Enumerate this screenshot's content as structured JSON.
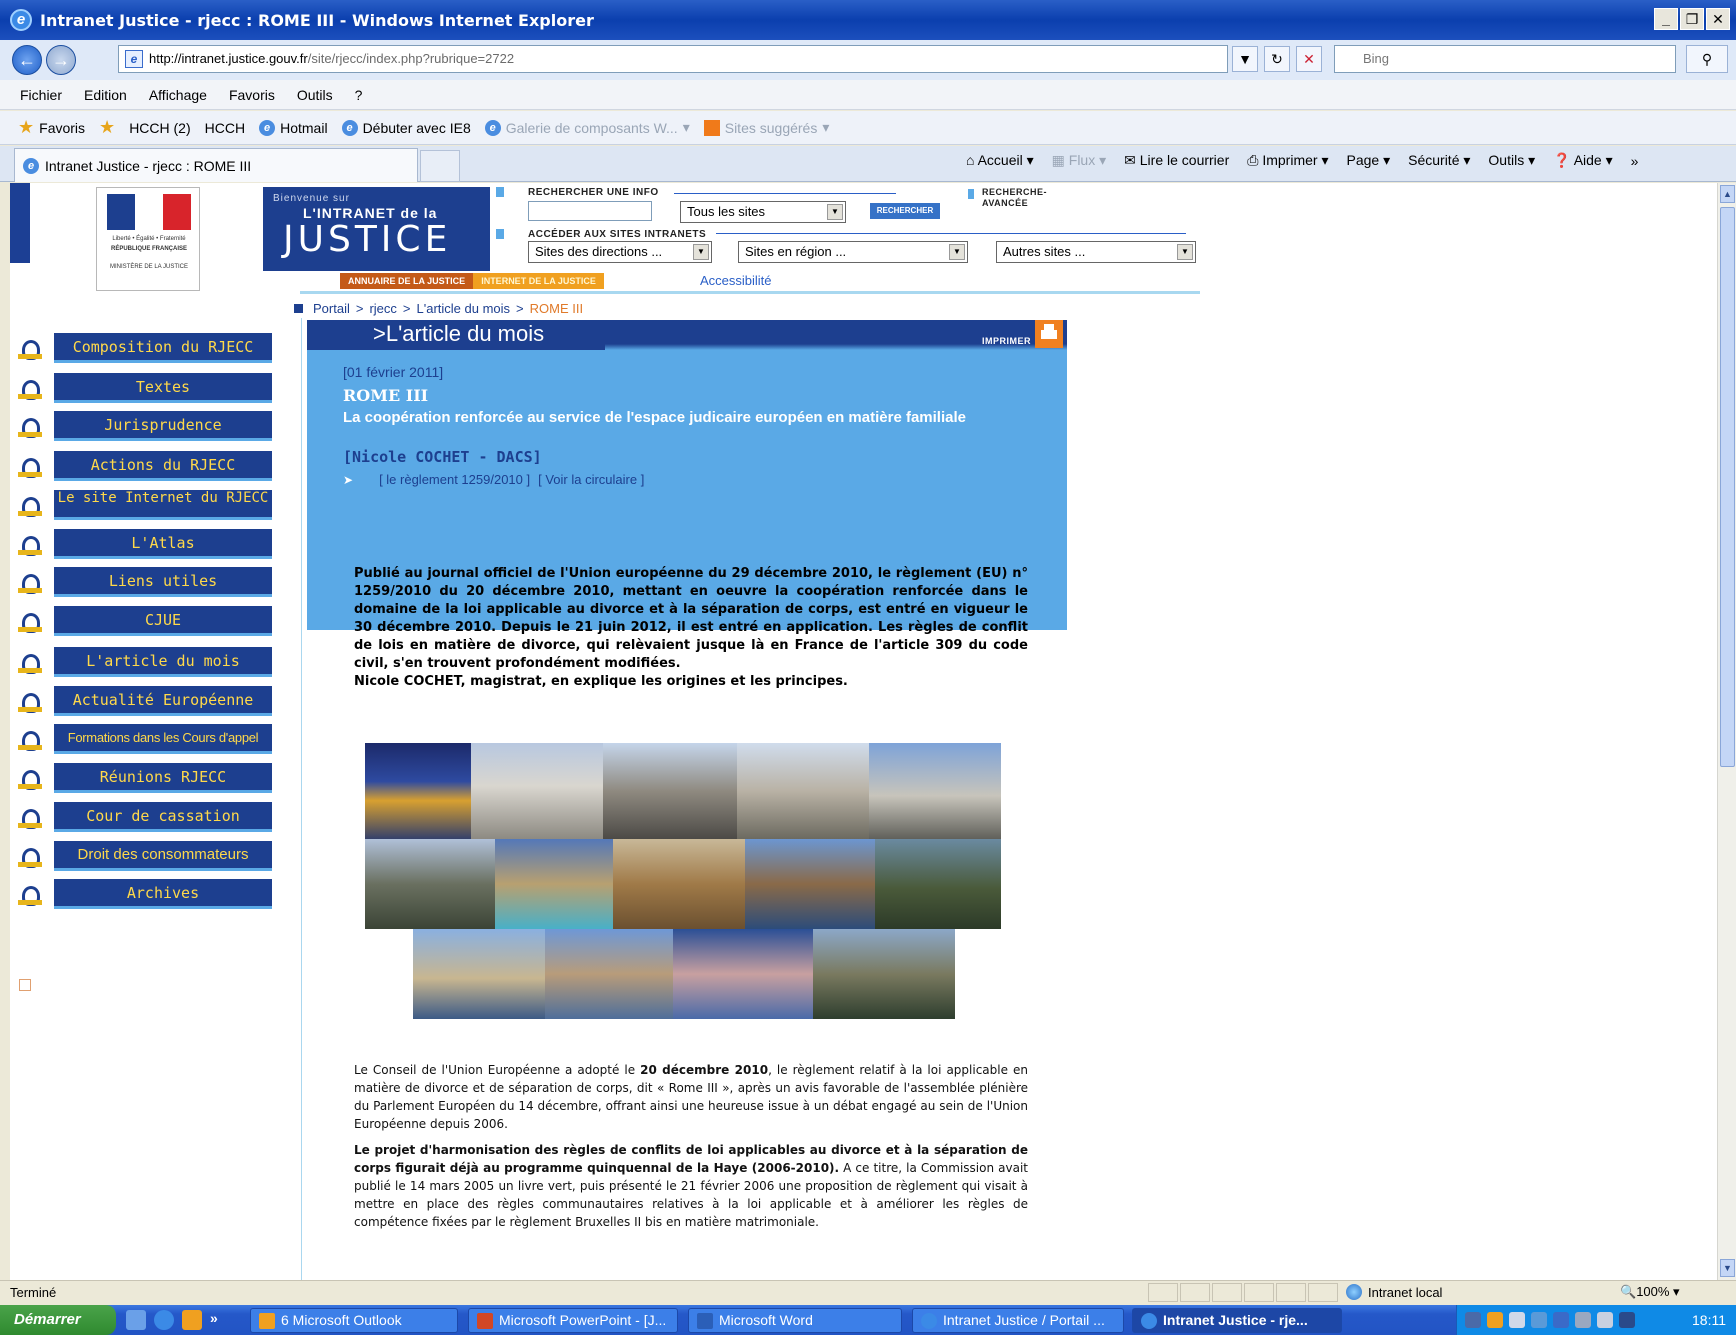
{
  "window": {
    "title": "Intranet Justice - rjecc : ROME III - Windows Internet Explorer",
    "buttons": [
      "_",
      "\u0010",
      "X"
    ]
  },
  "address": {
    "url_domain": "http://intranet.justice.gouv.fr",
    "url_path": "/site/rjecc/index.php?rubrique=2722",
    "search_placeholder": "Bing"
  },
  "menubar": [
    "Fichier",
    "Edition",
    "Affichage",
    "Favoris",
    "Outils",
    "?"
  ],
  "favorites_bar": {
    "favoris": "Favoris",
    "items": [
      "HCCH (2)",
      "HCCH",
      "Hotmail",
      "Débuter avec IE8",
      "Galerie de composants W...",
      "Sites suggérés"
    ]
  },
  "tab": {
    "label": "Intranet Justice - rjecc : ROME III"
  },
  "commandbar": [
    "Accueil",
    "Flux",
    "Lire le courrier",
    "Imprimer",
    "Page",
    "Sécurité",
    "Outils",
    "Aide"
  ],
  "site_header": {
    "banner_welcome": "Bienvenue sur",
    "banner_intranet": "L'INTRANET de la",
    "banner_justice": "JUSTICE",
    "search_label": "RECHERCHER UNE INFO",
    "search_scope": "Tous les sites",
    "search_button": "RECHERCHER",
    "advanced_search": "RECHERCHE- AVANCÉE",
    "sites_label": "ACCÉDER AUX SITES INTRANETS",
    "select_directions": "Sites des directions ...",
    "select_region": "Sites en région ...",
    "select_other": "Autres sites ...",
    "annuaire": "ANNUAIRE DE LA JUSTICE",
    "internet": "INTERNET DE LA JUSTICE",
    "accessibility": "Accessibilité",
    "logo_lines": [
      "Liberté • Égalité • Fraternité",
      "RÉPUBLIQUE FRANÇAISE",
      "MINISTÈRE DE LA JUSTICE"
    ]
  },
  "breadcrumb": [
    "Portail",
    ">",
    "rjecc",
    ">",
    "L'article du mois",
    ">",
    "ROME III"
  ],
  "left_menu": [
    "Composition du RJECC",
    "Textes",
    "Jurisprudence",
    "Actions du RJECC",
    "Le site Internet du RJECC",
    "L'Atlas",
    "Liens utiles",
    "CJUE",
    "L'article du mois",
    "Actualité Européenne",
    "Formations dans les Cours d'appel",
    "Réunions RJECC",
    "Cour de cassation",
    "Droit des consommateurs",
    "Archives"
  ],
  "article": {
    "section_title": ">L'article du mois",
    "print_label": "IMPRIMER",
    "date": "[01 février 2011]",
    "title": "ROME III",
    "subtitle": "La coopération renforcée au service de l'espace judicaire européen en matière familiale",
    "author": "[Nicole COCHET - DACS]",
    "link1": "[ le règlement 1259/2010 ]",
    "link2": "[ Voir la circulaire ]",
    "lead": [
      "Publié au journal officiel de l'Union européenne du 29 décembre 2010, le règlement (EU) n° 1259/2010 du 20 décembre 2010, mettant en oeuvre la coopération renforcée dans le domaine de la loi applicable au divorce et à la séparation de corps, est entré en vigueur le 30 décembre 2010. Depuis le 21 juin 2012, il est entré en application. Les règles de conflit de lois en matière de divorce, qui relèvaient jusque là en France de l'article 309 du code civil, s'en trouvent profondément modifiées.",
      "Nicole COCHET, magistrat, en explique les origines et les principes."
    ],
    "p1_a": "Le Conseil de l'Union Européenne a adopté le ",
    "p1_b": "20 décembre 2010",
    "p1_c": ", le règlement relatif à la loi applicable en matière de divorce et de séparation de corps, dit « Rome III », après un avis favorable de l'assemblée plénière du Parlement Européen du 14 décembre, offrant ainsi une heureuse issue à un débat engagé au sein de l'Union Européenne depuis 2006.",
    "p2_bold": "Le projet d'harmonisation des règles de conflits de loi applicables au divorce et à la séparation de corps figurait déjà au programme quinquennal de la Haye (2006-2010).",
    "p2_rest": " A ce titre, la Commission avait publié le 14 mars 2005 un livre vert, puis présenté le 21 février 2006 une proposition de règlement qui visait à mettre en place des règles communautaires relatives à la loi applicable et à améliorer les règles de compétence fixées par le règlement  Bruxelles II bis en matière matrimoniale."
  },
  "statusbar": {
    "status": "Terminé",
    "zone": "Intranet local",
    "zoom": "100%"
  },
  "taskbar": {
    "start": "Démarrer",
    "tasks": [
      "6 Microsoft Outlook",
      "Microsoft PowerPoint - [J...",
      "Microsoft Word",
      "Intranet Justice / Portail ...",
      "Intranet Justice - rje..."
    ],
    "clock": "18:11"
  }
}
